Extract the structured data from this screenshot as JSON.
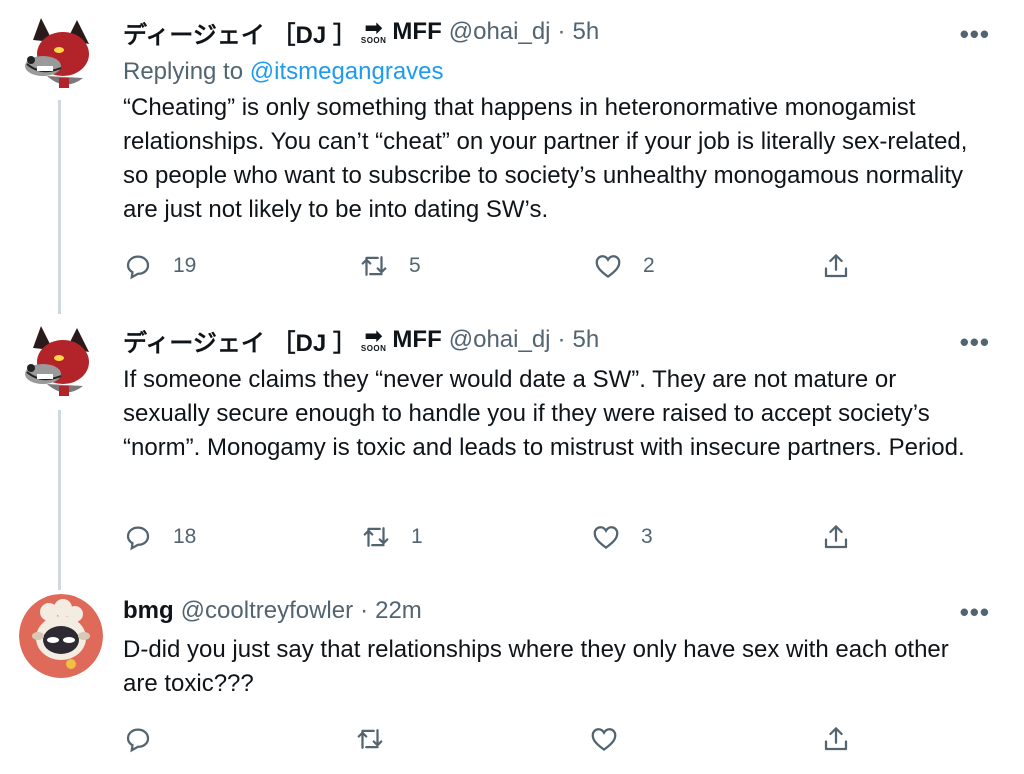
{
  "tweets": [
    {
      "display_name": "ディージェイ ［DJ ］",
      "badge_word": "SOON",
      "name_suffix": "MFF",
      "handle": "@ohai_dj",
      "separator": "·",
      "time": "5h",
      "replying_prefix": "Replying to",
      "replying_handle": "@itsmegangraves",
      "text": "“Cheating” is only something that happens in heteronormative monogamist relationships. You can’t “cheat” on your partner if your job is literally sex-related, so people who want to subscribe to society’s unhealthy monogamous normality are just not likely to be into dating SW’s.",
      "replies": "19",
      "retweets": "5",
      "likes": "2",
      "avatar_icon": "wolf-avatar"
    },
    {
      "display_name": "ディージェイ ［DJ ］",
      "badge_word": "SOON",
      "name_suffix": "MFF",
      "handle": "@ohai_dj",
      "separator": "·",
      "time": "5h",
      "text": "If someone claims they “never would date a SW”. They are not mature or sexually secure enough to handle you if they were raised to accept society’s “norm”. Monogamy is toxic and leads to mistrust with insecure partners. Period.",
      "replies": "18",
      "retweets": "1",
      "likes": "3",
      "avatar_icon": "wolf-avatar"
    },
    {
      "display_name": "bmg",
      "handle": "@cooltreyfowler",
      "separator": "·",
      "time": "22m",
      "text": "D-did you just say that relationships where they only have sex with each other are toxic???",
      "avatar_icon": "lamb-avatar"
    }
  ],
  "icons": {
    "more": "more-icon",
    "reply": "reply-icon",
    "retweet": "retweet-icon",
    "like": "heart-icon",
    "share": "share-icon"
  },
  "colors": {
    "link": "#1d9bf0",
    "secondary_text": "#536471",
    "thread_line": "#cfd9de"
  }
}
